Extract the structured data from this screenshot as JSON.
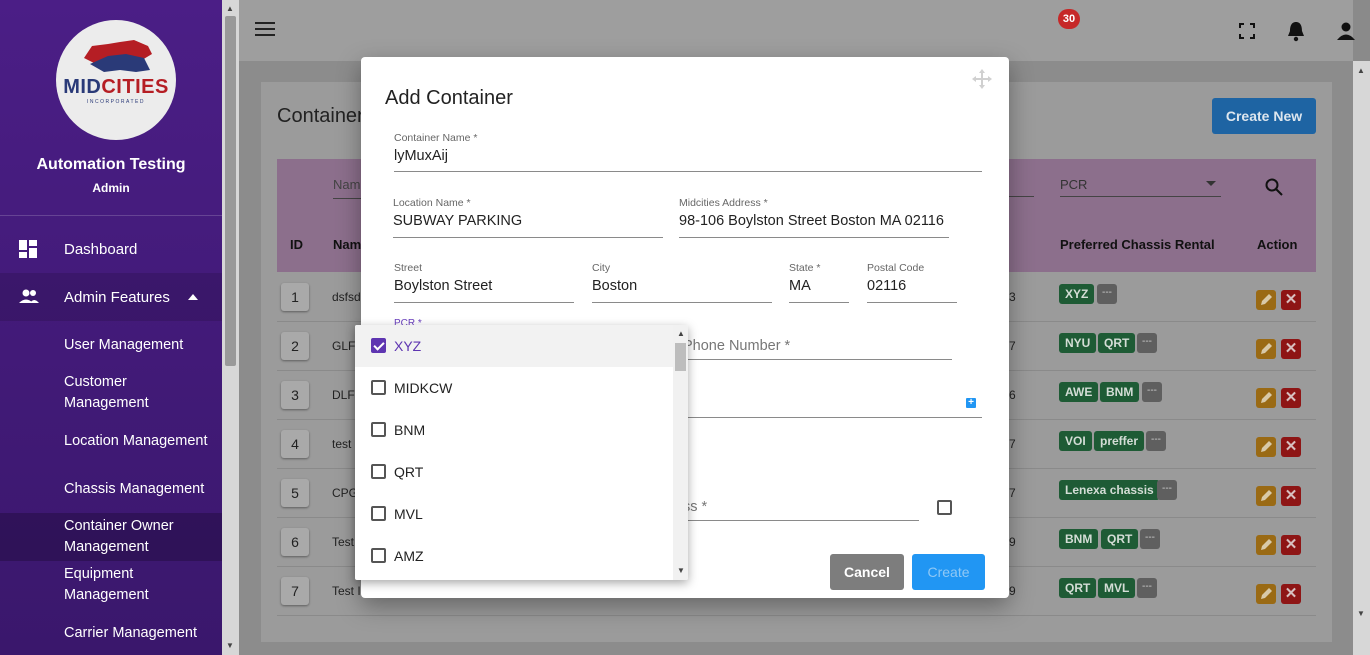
{
  "sidebar": {
    "logo_text_a": "MID",
    "logo_text_b": "CITIES",
    "logo_sub": "INCORPORATED",
    "app_name": "Automation Testing",
    "role": "Admin",
    "items": [
      {
        "label": "Dashboard",
        "icon": "dashboard-icon"
      },
      {
        "label": "Admin Features",
        "icon": "people-icon"
      }
    ],
    "sub_items": [
      {
        "label": "User Management"
      },
      {
        "label": "Customer Management"
      },
      {
        "label": "Location Management"
      },
      {
        "label": "Chassis Management"
      },
      {
        "label": "Container Owner Management"
      },
      {
        "label": "Equipment Management"
      },
      {
        "label": "Carrier Management"
      }
    ]
  },
  "topbar": {
    "notification_count": "30"
  },
  "page": {
    "title": "Container",
    "create_new": "Create New",
    "filters": {
      "name_placeholder": "Nam",
      "pcr": "PCR"
    },
    "columns": {
      "id": "ID",
      "name": "Nam",
      "pcr": "Preferred Chassis Rental",
      "action": "Action"
    },
    "rows": [
      {
        "id": "1",
        "name": "dsfsd",
        "num": "3",
        "chips": [
          "XYZ"
        ]
      },
      {
        "id": "2",
        "name": "GLF",
        "num": "7",
        "chips": [
          "NYU",
          "QRT"
        ]
      },
      {
        "id": "3",
        "name": "DLF",
        "num": "6",
        "chips": [
          "AWE",
          "BNM"
        ]
      },
      {
        "id": "4",
        "name": "test",
        "num": "7",
        "chips": [
          "VOI",
          "preffer"
        ]
      },
      {
        "id": "5",
        "name": "CPG",
        "num": "7",
        "chips": [
          "Lenexa chassis"
        ]
      },
      {
        "id": "6",
        "name": "Test",
        "num": "9",
        "chips": [
          "BNM",
          "QRT"
        ]
      },
      {
        "id": "7",
        "name": "Test I",
        "num": "9",
        "chips": [
          "QRT",
          "MVL"
        ]
      }
    ],
    "more_chip": "---"
  },
  "modal": {
    "title": "Add Container",
    "container_name": {
      "label": "Container Name *",
      "value": "lyMuxAij"
    },
    "location_name": {
      "label": "Location Name *",
      "value": "SUBWAY PARKING"
    },
    "midcities_address": {
      "label": "Midcities Address *",
      "value": "98-106 Boylston Street Boston MA 02116"
    },
    "street": {
      "label": "Street",
      "value": "Boylston Street"
    },
    "city": {
      "label": "City",
      "value": "Boston"
    },
    "state": {
      "label": "State *",
      "value": "MA"
    },
    "postal_code": {
      "label": "Postal Code",
      "value": "02116"
    },
    "pcr_label": "PCR *",
    "phone_placeholder": "Phone Number *",
    "email_placeholder": "ss *",
    "cancel": "Cancel",
    "create": "Create"
  },
  "pcr_dropdown": {
    "options": [
      {
        "label": "XYZ",
        "checked": true
      },
      {
        "label": "MIDKCW",
        "checked": false
      },
      {
        "label": "BNM",
        "checked": false
      },
      {
        "label": "QRT",
        "checked": false
      },
      {
        "label": "MVL",
        "checked": false
      },
      {
        "label": "AMZ",
        "checked": false
      }
    ]
  },
  "colors": {
    "sidebar": "#4b1e86",
    "primary": "#2196f3",
    "chip": "#1b7f3a",
    "accent": "#5e35b1"
  }
}
